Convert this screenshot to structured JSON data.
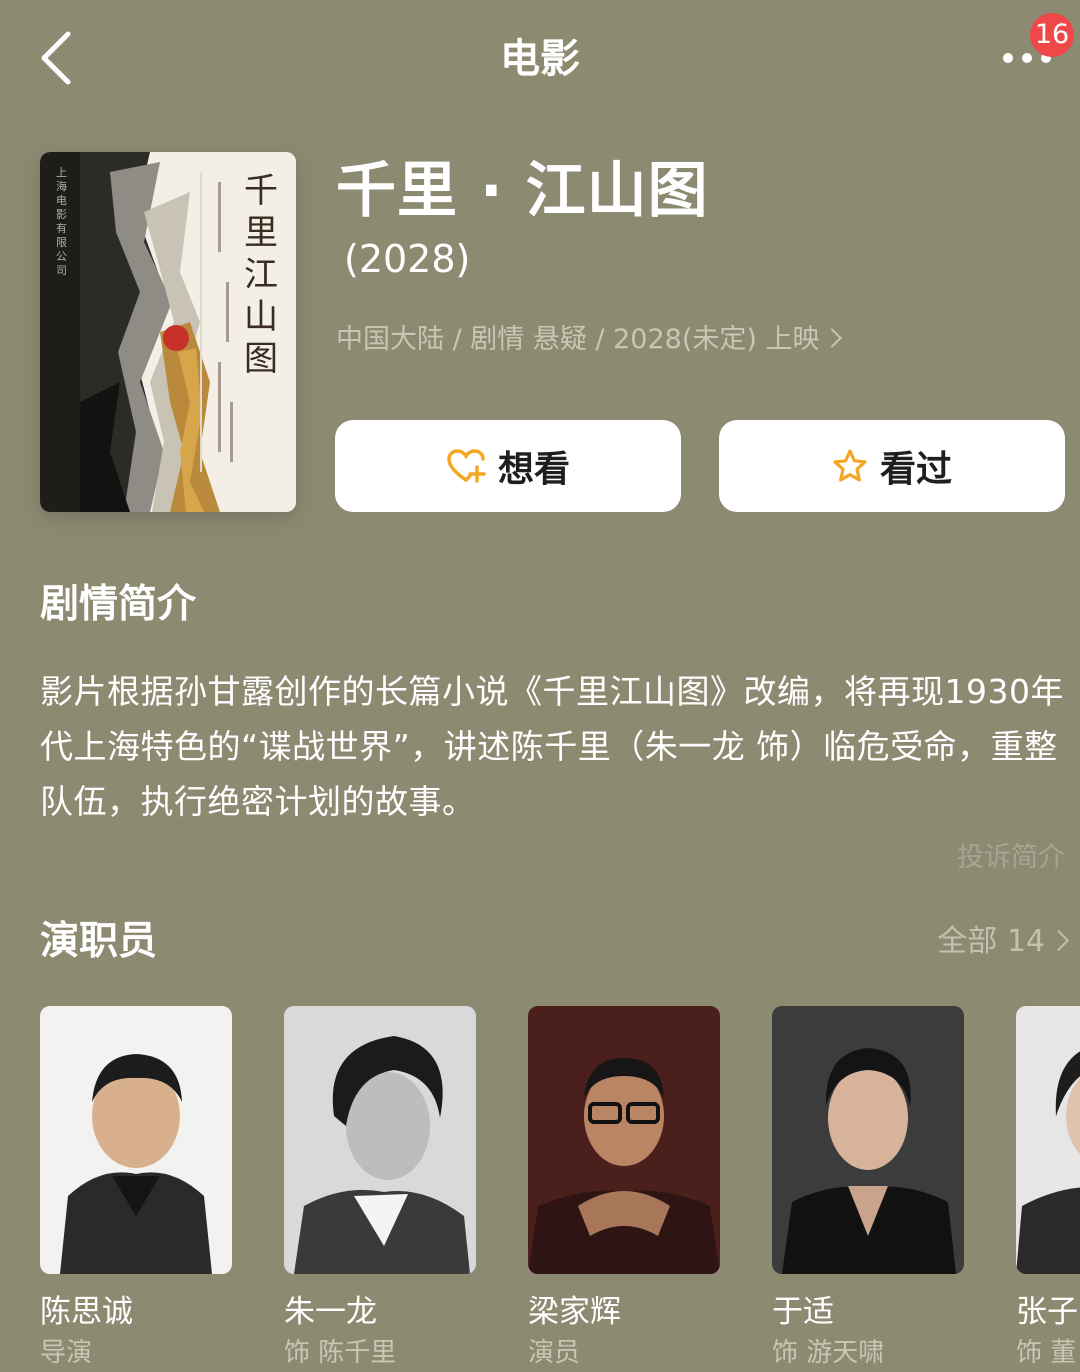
{
  "header": {
    "title": "电影",
    "badge_count": "16",
    "back_icon": "chevron-left-icon",
    "more_icon": "more-dots-icon"
  },
  "movie": {
    "poster_title": "千里江山图",
    "title": "千里 · 江山图",
    "year": "(2028)",
    "meta": "中国大陆 / 剧情 悬疑 / 2028(未定) 上映"
  },
  "actions": {
    "want_label": "想看",
    "want_icon": "heart-plus-icon",
    "seen_label": "看过",
    "seen_icon": "star-icon"
  },
  "synopsis": {
    "heading": "剧情简介",
    "text": "影片根据孙甘露创作的长篇小说《千里江山图》改编，将再现1930年代上海特色的“谍战世界”，讲述陈千里（朱一龙 饰）临危受命，重整队伍，执行绝密计划的故事。",
    "complaint": "投诉简介"
  },
  "cast": {
    "heading": "演职员",
    "all_label": "全部 14",
    "members": [
      {
        "name": "陈思诚",
        "role": "导演"
      },
      {
        "name": "朱一龙",
        "role": "饰 陈千里"
      },
      {
        "name": "梁家辉",
        "role": "演员"
      },
      {
        "name": "于适",
        "role": "饰 游天啸"
      },
      {
        "name": "张子",
        "role": "饰 董"
      }
    ]
  },
  "colors": {
    "background": "#8d8a72",
    "accent_icon": "#f5a623",
    "badge": "#f04848"
  }
}
